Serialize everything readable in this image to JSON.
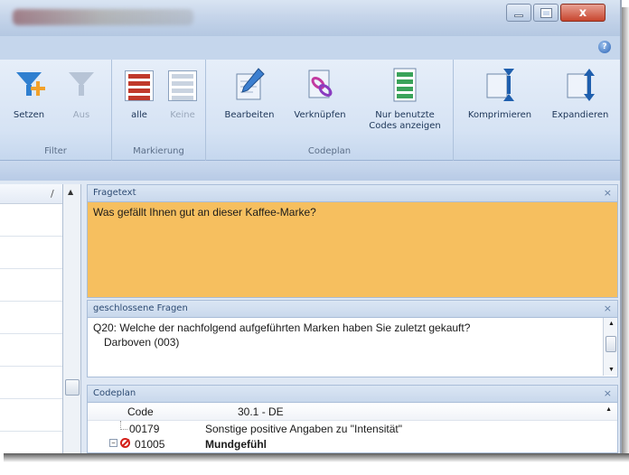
{
  "window": {
    "close_glyph": "x"
  },
  "help_glyph": "?",
  "ribbon": {
    "groups": [
      {
        "caption": "Filter",
        "buttons": [
          {
            "label": "Setzen",
            "enabled": true,
            "icon": "funnel-add-icon"
          },
          {
            "label": "Aus",
            "enabled": false,
            "icon": "funnel-icon"
          }
        ]
      },
      {
        "caption": "Markierung",
        "buttons": [
          {
            "label": "alle",
            "enabled": true,
            "icon": "list-mark-all-icon"
          },
          {
            "label": "Keine",
            "enabled": false,
            "icon": "list-mark-none-icon"
          }
        ]
      },
      {
        "caption": "Codeplan",
        "buttons": [
          {
            "label": "Bearbeiten",
            "icon": "edit-pencil-icon"
          },
          {
            "label": "Verknüpfen",
            "icon": "link-chain-icon"
          },
          {
            "label": "Nur benutzte Codes anzeigen",
            "icon": "used-codes-icon"
          }
        ]
      },
      {
        "caption": "",
        "buttons": [
          {
            "label": "Komprimieren",
            "icon": "collapse-icon"
          },
          {
            "label": "Expandieren",
            "icon": "expand-icon"
          }
        ]
      }
    ]
  },
  "leftpane": {
    "header_glyph": "/"
  },
  "panels": {
    "fragetext": {
      "title": "Fragetext",
      "text": "Was gefällt Ihnen gut an dieser Kaffee-Marke?"
    },
    "geschlossen": {
      "title": "geschlossene Fragen",
      "line1": "Q20: Welche der nachfolgend aufgeführten Marken haben Sie zuletzt gekauft?",
      "line2": "Darboven (003)"
    },
    "codeplan": {
      "title": "Codeplan",
      "col_code": "Code",
      "col_desc": "30.1 - DE",
      "rows": [
        {
          "code": "00179",
          "desc": "Sonstige positive Angaben zu \"Intensität\"",
          "bold": false
        },
        {
          "code": "01005",
          "desc": "Mundgefühl",
          "bold": true
        }
      ]
    }
  },
  "close_glyph": "×"
}
